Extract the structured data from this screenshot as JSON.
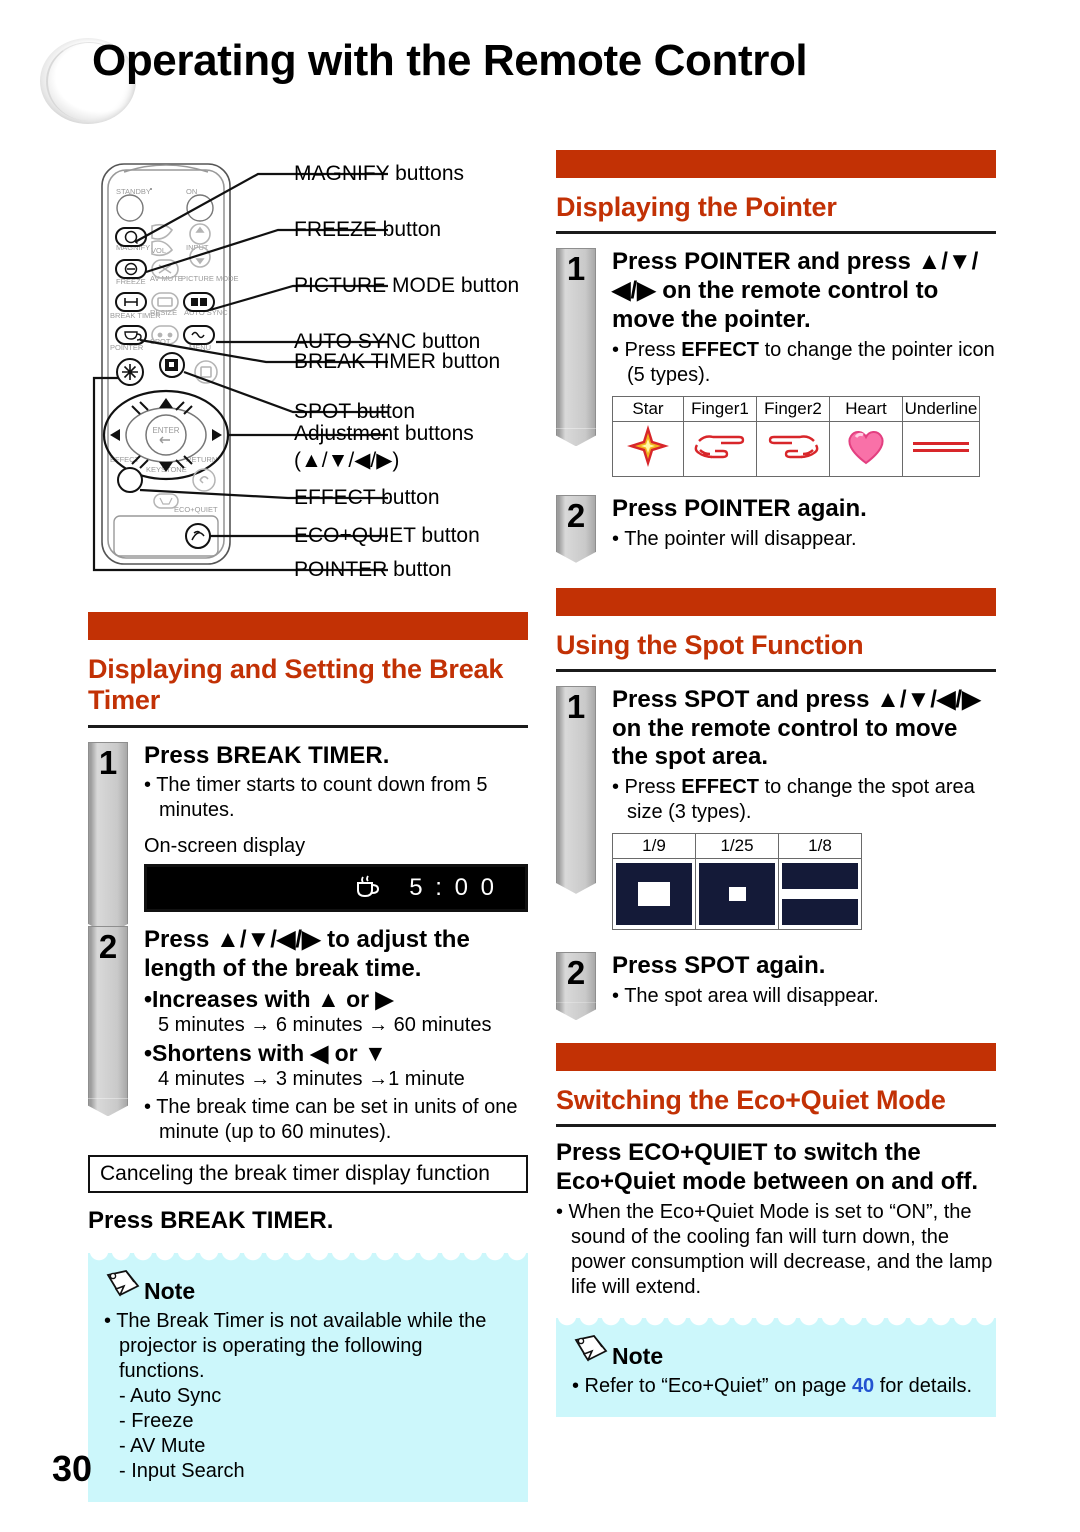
{
  "page_title": "Operating with the Remote Control",
  "page_number": "30",
  "colors": {
    "accent": "#C23105",
    "note_bg": "#CCF7FB",
    "page_ref": "#2353D1",
    "spot_fill": "#141A38"
  },
  "remote_callouts": [
    {
      "label": "MAGNIFY buttons"
    },
    {
      "label": "FREEZE button"
    },
    {
      "label": "PICTURE MODE button"
    },
    {
      "label": "AUTO SYNC button"
    },
    {
      "label": "BREAK TIMER button"
    },
    {
      "label": "SPOT button"
    },
    {
      "label": "Adjustment buttons"
    },
    {
      "label": "(▲/▼/◀/▶)"
    },
    {
      "label": "EFFECT button"
    },
    {
      "label": "ECO+QUIET button"
    },
    {
      "label": "POINTER button"
    }
  ],
  "remote_face": {
    "standby": "STANDBY",
    "on": "ON",
    "magnify": "MAGNIFY",
    "vol": "VOL",
    "input": "INPUT",
    "freeze": "FREEZE",
    "av_mute": "AV MUTE",
    "picture_mode": "PICTURE MODE",
    "break_timer": "BREAK TIMER",
    "resize": "RESIZE",
    "auto_sync": "AUTO SYNC",
    "pointer": "POINTER",
    "spot": "SPOT",
    "menu": "MENU",
    "enter": "ENTER",
    "effect": "EFFECT",
    "keystone": "KEYSTONE",
    "return": "RETURN",
    "eco_quiet": "ECO+QUIET"
  },
  "break_timer": {
    "title": "Displaying and Setting the Break Timer",
    "step1": {
      "num": "1",
      "head_pre": "Press ",
      "head_strong": "BREAK TIMER.",
      "bullet": "• The timer starts to count down from 5 minutes.",
      "osd_label": "On-screen display",
      "osd_time": "5 : 0 0"
    },
    "step2": {
      "num": "2",
      "head": "Press ▲/▼/◀/▶ to adjust the length of the break time.",
      "inc_head": "•Increases with ▲ or ▶",
      "inc_body": "5 minutes → 6 minutes → 60 minutes",
      "dec_head": "•Shortens with ◀ or ▼",
      "dec_body": "4 minutes → 3 minutes →1 minute",
      "note_bullet": "• The break time can be set in units of one minute (up to 60 minutes)."
    },
    "cancel_box": "Canceling the break timer display function",
    "cancel_press_pre": "Press ",
    "cancel_press_strong": "BREAK TIMER.",
    "note": {
      "heading": "Note",
      "bullet": "• The Break Timer is not available while the projector is operating the following functions.",
      "items": [
        "- Auto Sync",
        "- Freeze",
        "- AV Mute",
        "- Input Search"
      ]
    }
  },
  "pointer": {
    "title": "Displaying the Pointer",
    "step1": {
      "num": "1",
      "head_a": "Press ",
      "head_b": "POINTER",
      "head_c": " and press ▲/▼/◀/▶ on the remote control to move the pointer.",
      "bullet_a": "• Press ",
      "bullet_b": "EFFECT",
      "bullet_c": " to change the pointer icon (5 types).",
      "table_headers": [
        "Star",
        "Finger1",
        "Finger2",
        "Heart",
        "Underline"
      ],
      "table_icons": [
        "star-icon",
        "finger1-icon",
        "finger2-icon",
        "heart-icon",
        "underline-icon"
      ]
    },
    "step2": {
      "num": "2",
      "head_a": "Press ",
      "head_b": "POINTER",
      "head_c": " again.",
      "bullet": "• The pointer will disappear."
    }
  },
  "spot": {
    "title": "Using the Spot Function",
    "step1": {
      "num": "1",
      "head_a": "Press ",
      "head_b": "SPOT",
      "head_c": " and press ▲/▼/◀/▶ on the remote control to move the spot area.",
      "bullet_a": "• Press ",
      "bullet_b": "EFFECT",
      "bullet_c": " to change the spot area size (3 types).",
      "table_headers": [
        "1/9",
        "1/25",
        "1/8"
      ]
    },
    "step2": {
      "num": "2",
      "head_a": "Press ",
      "head_b": "SPOT",
      "head_c": " again.",
      "bullet": "• The spot area will disappear."
    }
  },
  "eco": {
    "title": "Switching the Eco+Quiet Mode",
    "head_a": "Press ",
    "head_b": "ECO+QUIET",
    "head_c": " to switch the Eco+Quiet mode between on and off.",
    "bullet": "• When the Eco+Quiet Mode is set to “ON”, the sound of the cooling fan will turn down, the power consumption will decrease, and the lamp life will extend.",
    "note": {
      "heading": "Note",
      "bullet_a": "• Refer to “Eco+Quiet” on page ",
      "bullet_page": "40",
      "bullet_b": " for details."
    }
  }
}
